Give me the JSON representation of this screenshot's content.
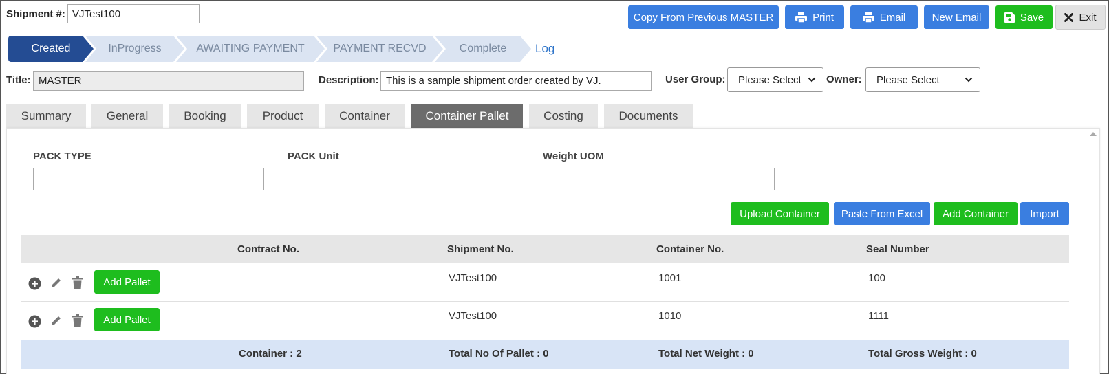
{
  "header": {
    "shipment_label": "Shipment #:",
    "shipment_value": "VJTest100",
    "buttons": {
      "copy": "Copy From Previous MASTER",
      "print": "Print",
      "email": "Email",
      "new_email": "New Email",
      "save": "Save",
      "exit": "Exit"
    }
  },
  "steps": [
    "Created",
    "InProgress",
    "AWAITING PAYMENT",
    "PAYMENT RECVD",
    "Complete"
  ],
  "active_step": "Created",
  "log_link": "Log",
  "form": {
    "title_label": "Title:",
    "title_value": "MASTER",
    "description_label": "Description:",
    "description_value": "This is a sample shipment order created by VJ.",
    "user_group_label": "User Group:",
    "user_group_value": "Please Select",
    "owner_label": "Owner:",
    "owner_value": "Please Select"
  },
  "tabs": [
    "Summary",
    "General",
    "Booking",
    "Product",
    "Container",
    "Container Pallet",
    "Costing",
    "Documents"
  ],
  "active_tab": "Container Pallet",
  "pallet_fields": {
    "pack_type_label": "PACK TYPE",
    "pack_type_value": "",
    "pack_unit_label": "PACK Unit",
    "pack_unit_value": "",
    "weight_uom_label": "Weight UOM",
    "weight_uom_value": ""
  },
  "actions": {
    "upload": "Upload Container",
    "paste": "Paste From Excel",
    "add": "Add Container",
    "import": "Import"
  },
  "table": {
    "columns": [
      "Contract No.",
      "Shipment No.",
      "Container No.",
      "Seal Number"
    ],
    "add_pallet_label": "Add Pallet",
    "rows": [
      {
        "contract": "",
        "shipment": "VJTest100",
        "container": "1001",
        "seal": "100"
      },
      {
        "contract": "",
        "shipment": "VJTest100",
        "container": "1010",
        "seal": "1111"
      }
    ],
    "footer": {
      "container": "Container : 2",
      "pallets": "Total No Of Pallet : 0",
      "net": "Total Net Weight : 0",
      "gross": "Total Gross Weight : 0"
    }
  },
  "colors": {
    "primary_blue": "#3a7ee0",
    "success_green": "#1ebd1e",
    "active_step": "#244c93",
    "inactive_step": "#dbe4f2",
    "active_tab": "#6c6c6c",
    "footer_row": "#d8e4f6"
  }
}
